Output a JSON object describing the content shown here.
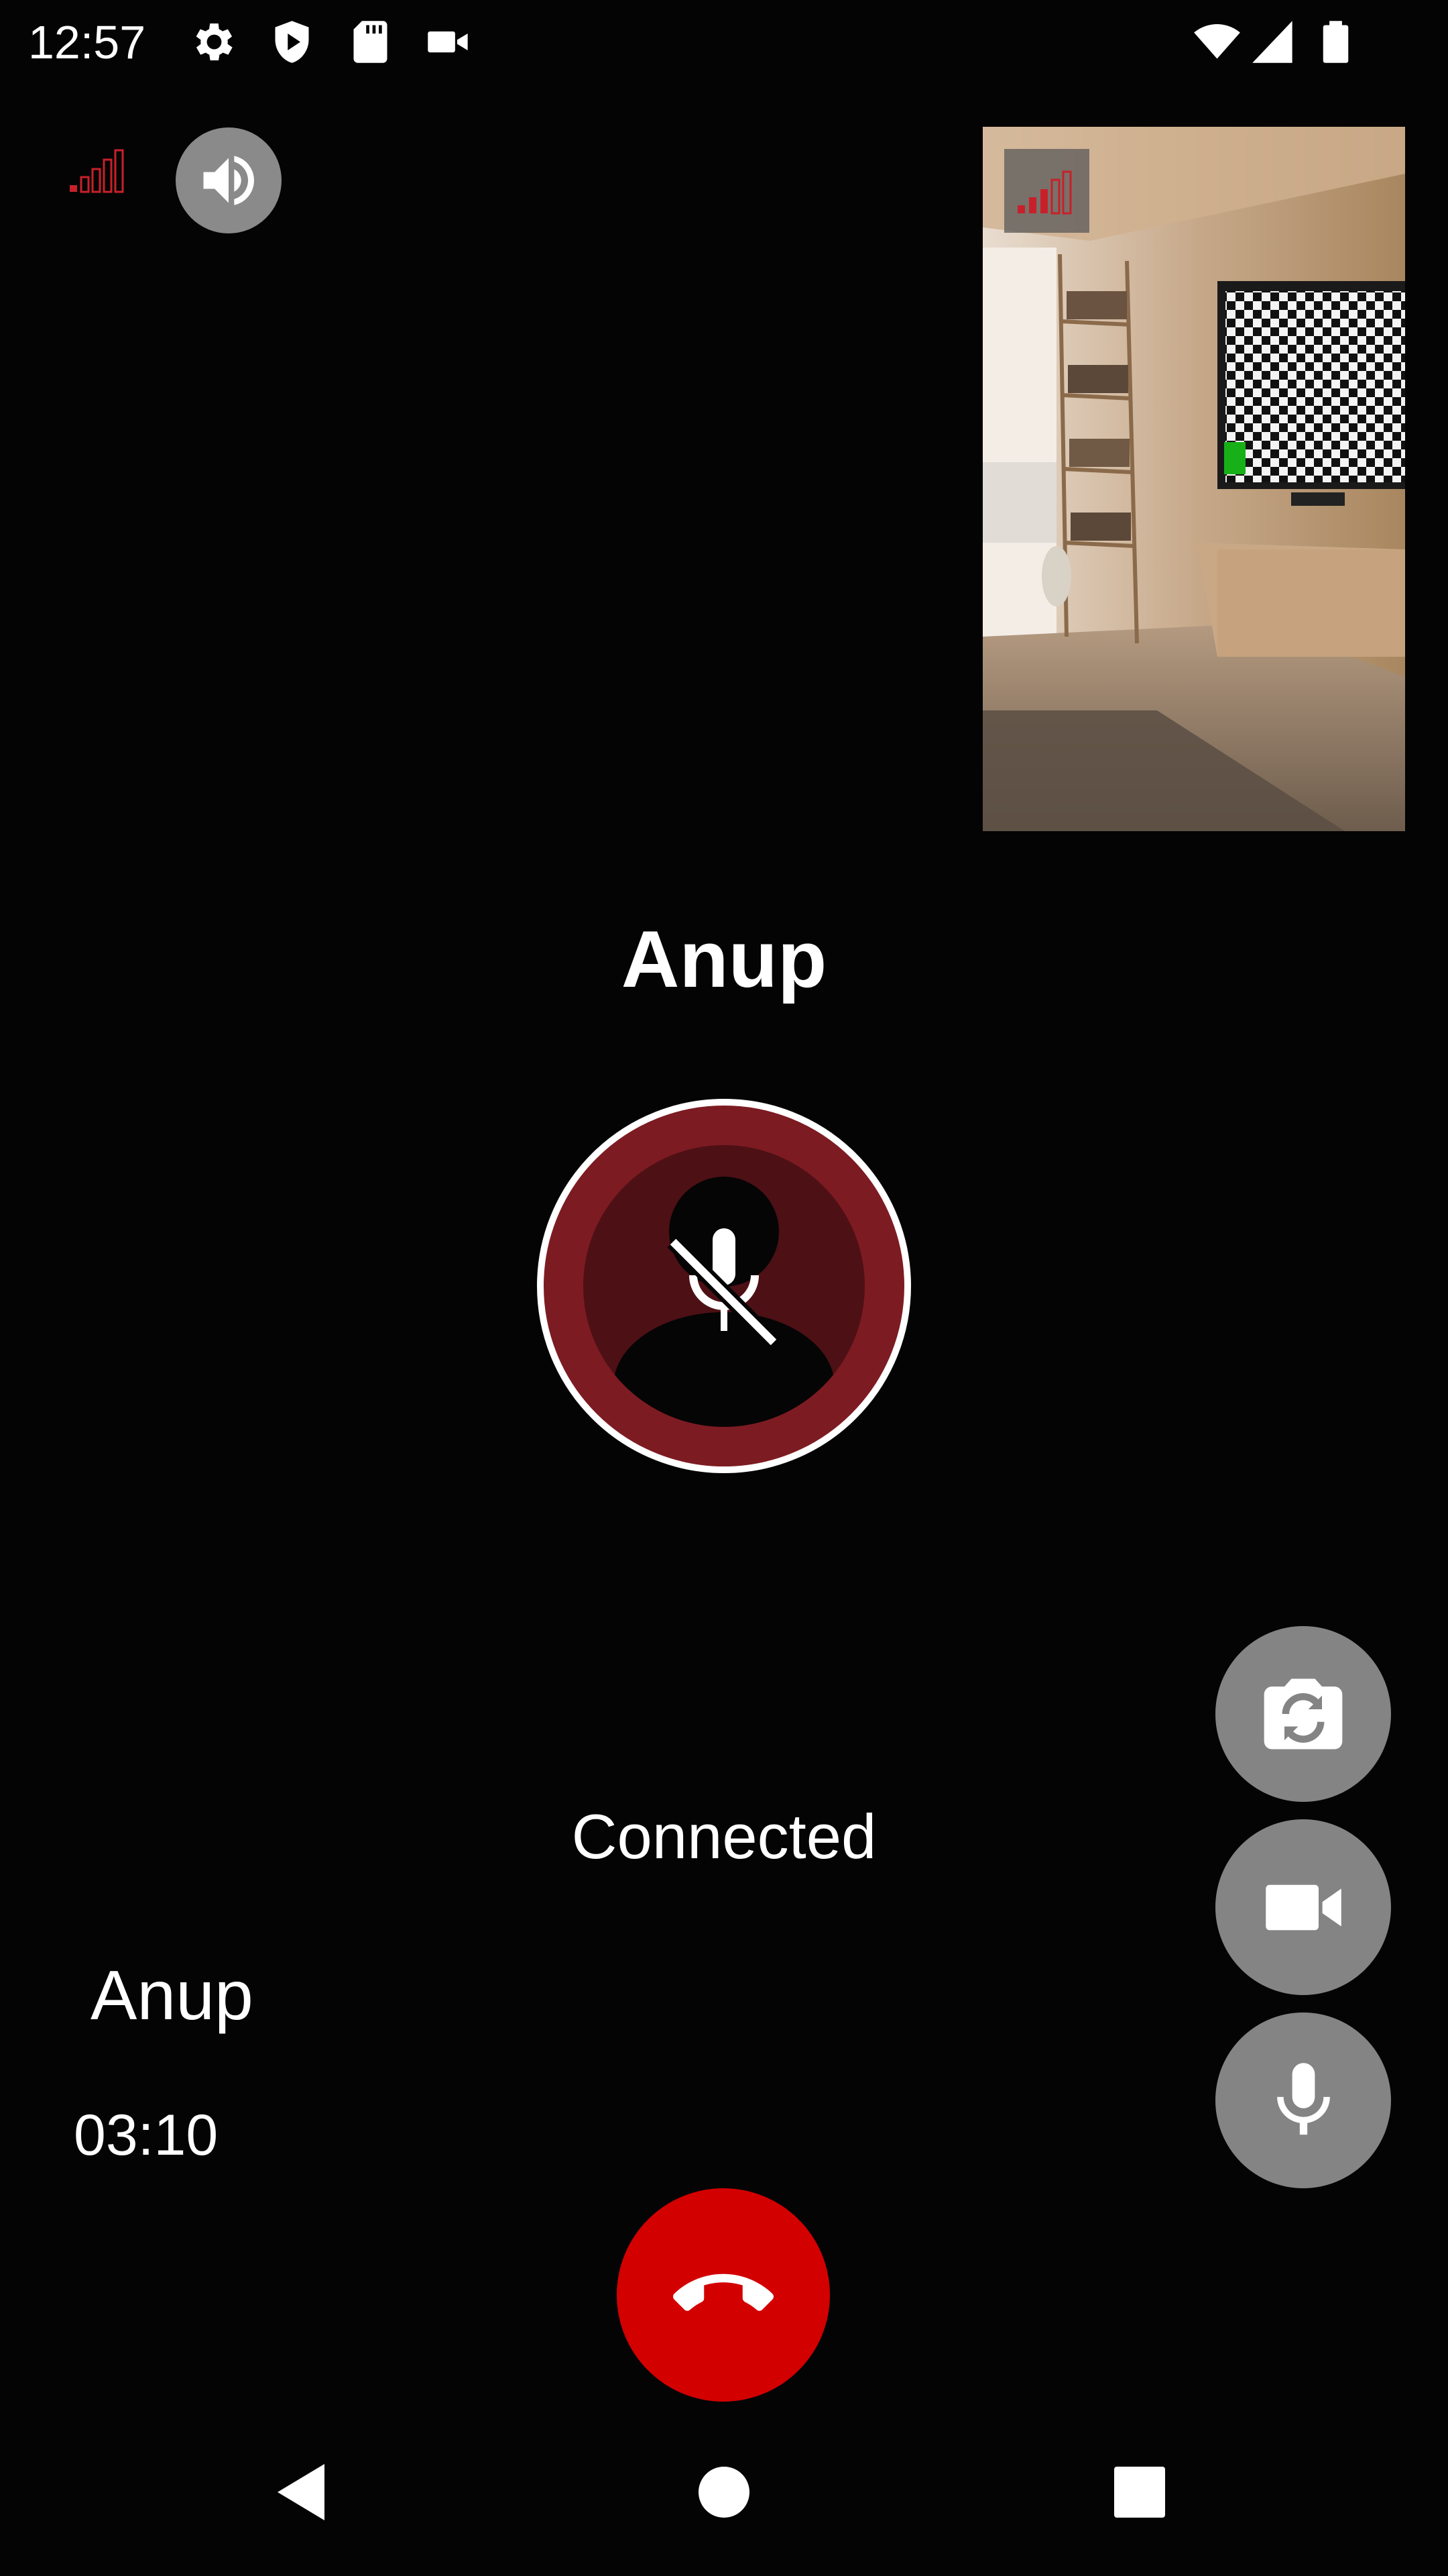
{
  "status_bar": {
    "time": "12:57",
    "left_icons": [
      "settings-icon",
      "shield-play-icon",
      "sd-card-icon",
      "video-camera-icon"
    ],
    "right_icons": [
      "wifi-icon",
      "cellular-signal-icon",
      "battery-icon"
    ]
  },
  "call": {
    "caller_name": "Anup",
    "status": "Connected",
    "bottom_name": "Anup",
    "duration": "03:10",
    "microphone_muted": true,
    "speaker_on": true
  },
  "icons": {
    "call_quality": "signal-strength-icon",
    "speaker": "volume-up-icon",
    "switch_camera": "camera-switch-icon",
    "video": "video-camera-icon",
    "mic": "microphone-icon",
    "end_call": "hang-up-icon",
    "muted_overlay": "microphone-off-icon"
  },
  "colors": {
    "background": "#040404",
    "end_call": "#d30000",
    "avatar_ring": "#7d1b22",
    "signal_weak": "#c8202a",
    "button_gray": "#848484"
  },
  "nav_bar": {
    "buttons": [
      "back",
      "home",
      "recents"
    ]
  }
}
